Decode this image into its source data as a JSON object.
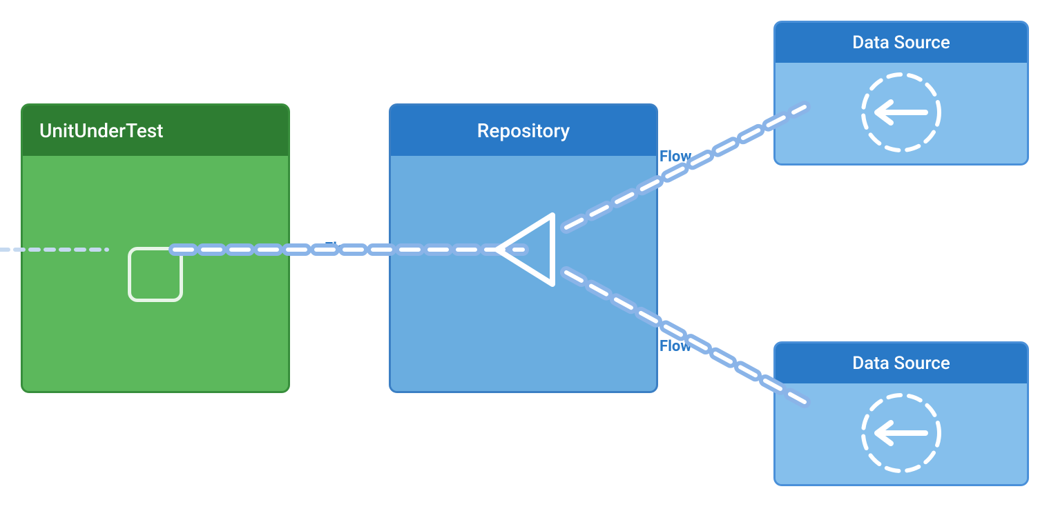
{
  "nodes": {
    "unitUnderTest": {
      "label": "UnitUnderTest"
    },
    "repository": {
      "label": "Repository"
    },
    "dataSourceTop": {
      "label": "Data Source"
    },
    "dataSourceBottom": {
      "label": "Data Source"
    }
  },
  "edges": {
    "mainFlow": {
      "label": "Flow"
    },
    "topFlow": {
      "label": "Flow"
    },
    "bottomFlow": {
      "label": "Flow"
    }
  },
  "colors": {
    "green_dark": "#2e7d32",
    "green_mid": "#4caf50",
    "blue_dark": "#2979c7",
    "blue_mid": "#5c9bd6",
    "blue_light": "#7eb8e8",
    "white": "#ffffff",
    "flow_label": "#3a7bd5"
  }
}
